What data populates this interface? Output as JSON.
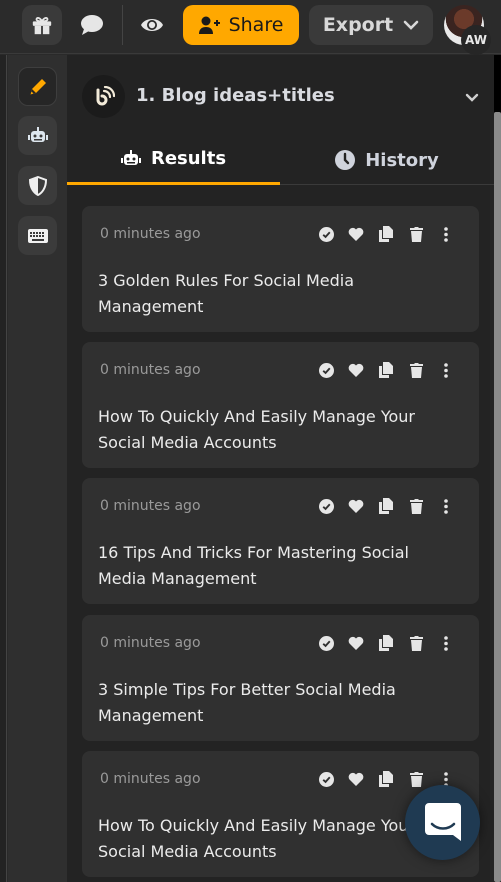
{
  "topbar": {
    "gift_icon": "gift-icon",
    "chat_icon": "chat-bubble-icon",
    "preview_icon": "eye-icon",
    "share_label": "Share",
    "export_label": "Export",
    "avatar_initials": "AW",
    "accent_color": "#ffa800"
  },
  "rail": {
    "items": [
      {
        "name": "write",
        "icon": "pencil-icon",
        "active": true
      },
      {
        "name": "ai-tools",
        "icon": "robot-icon",
        "active": false
      },
      {
        "name": "security",
        "icon": "shield-icon",
        "active": false
      },
      {
        "name": "shortcuts",
        "icon": "keyboard-icon",
        "active": false
      }
    ]
  },
  "tool": {
    "title": "1. Blog ideas+titles",
    "icon": "blog-feed-icon"
  },
  "tabs": {
    "results": "Results",
    "history": "History",
    "active": "Results"
  },
  "results": [
    {
      "time": "0 minutes ago",
      "text": "3 Golden Rules For Social Media Management"
    },
    {
      "time": "0 minutes ago",
      "text": "How To Quickly And Easily Manage Your Social Media Accounts"
    },
    {
      "time": "0 minutes ago",
      "text": "16 Tips And Tricks For Mastering Social Media Management"
    },
    {
      "time": "0 minutes ago",
      "text": "3 Simple Tips For Better Social Media Management"
    },
    {
      "time": "0 minutes ago",
      "text": "How To Quickly And Easily Manage Your Social Media Accounts"
    }
  ],
  "card_actions": [
    "check-circle-icon",
    "heart-icon",
    "copy-icon",
    "trash-icon",
    "more-vertical-icon"
  ],
  "chat_launcher": {
    "icon": "chat-widget-icon",
    "color": "#1f3a52"
  }
}
